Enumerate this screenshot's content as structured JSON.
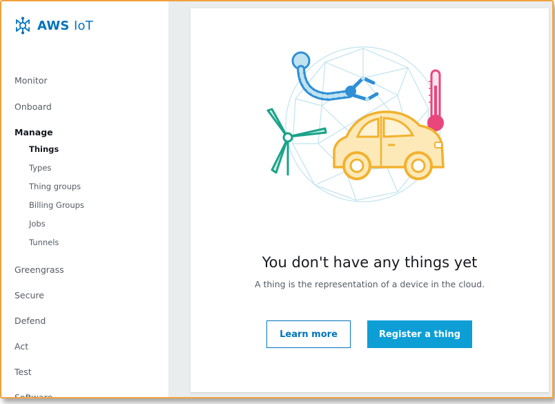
{
  "brand": {
    "name_bold": "AWS",
    "name_light": "IoT"
  },
  "sidebar": {
    "items": [
      {
        "label": "Monitor"
      },
      {
        "label": "Onboard"
      },
      {
        "label": "Manage",
        "active": true
      },
      {
        "label": "Greengrass"
      },
      {
        "label": "Secure"
      },
      {
        "label": "Defend"
      },
      {
        "label": "Act"
      },
      {
        "label": "Test"
      },
      {
        "label": "Software"
      }
    ],
    "manage_subitems": [
      {
        "label": "Things",
        "active": true
      },
      {
        "label": "Types"
      },
      {
        "label": "Thing groups"
      },
      {
        "label": "Billing Groups"
      },
      {
        "label": "Jobs"
      },
      {
        "label": "Tunnels"
      }
    ]
  },
  "main": {
    "empty_title": "You don't have any things yet",
    "empty_description": "A thing is the representation of a device in the cloud.",
    "learn_more_label": "Learn more",
    "register_label": "Register a thing"
  },
  "colors": {
    "brand_blue": "#0073bb",
    "primary_button": "#0e9ed6",
    "frame_border": "#f0a23c",
    "car_yellow": "#f7c94b",
    "turbine_green": "#1aa38a",
    "thermometer_pink": "#e8467c"
  }
}
